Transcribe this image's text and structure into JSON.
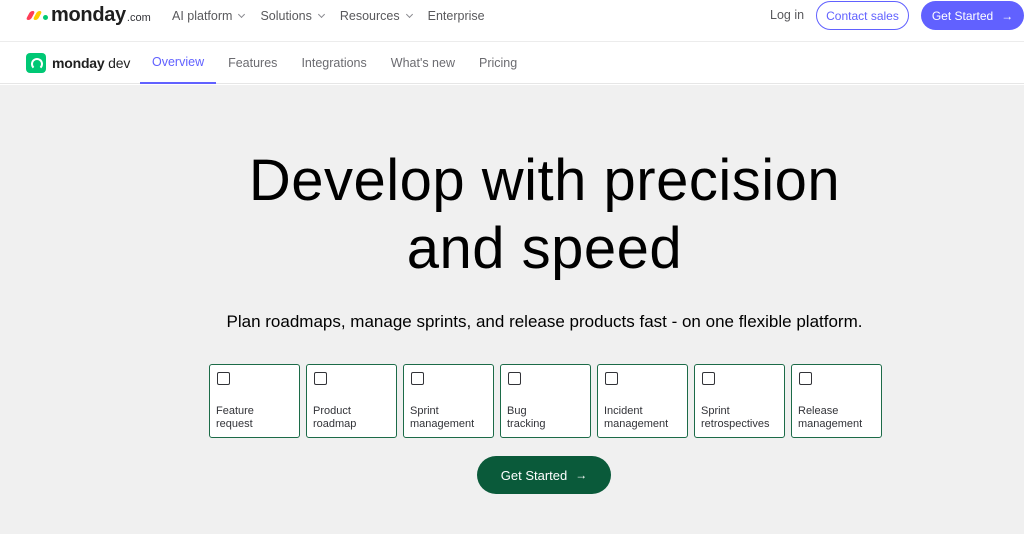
{
  "header": {
    "brand": "monday",
    "brand_tld": ".com",
    "nav": [
      {
        "label": "AI platform",
        "dropdown": true
      },
      {
        "label": "Solutions",
        "dropdown": true
      },
      {
        "label": "Resources",
        "dropdown": true
      },
      {
        "label": "Enterprise",
        "dropdown": false
      }
    ],
    "login": "Log in",
    "contact_sales": "Contact sales",
    "get_started": "Get Started",
    "accent_color": "#6161ff"
  },
  "subnav": {
    "product_bold": "monday",
    "product_light": " dev",
    "tabs": [
      {
        "label": "Overview",
        "active": true
      },
      {
        "label": "Features",
        "active": false
      },
      {
        "label": "Integrations",
        "active": false
      },
      {
        "label": "What's new",
        "active": false
      },
      {
        "label": "Pricing",
        "active": false
      }
    ]
  },
  "hero": {
    "headline_line1": "Develop with precision",
    "headline_line2": "and speed",
    "subtitle": "Plan roadmaps, manage sprints, and release products fast - on one flexible platform.",
    "options": [
      {
        "line1": "Feature",
        "line2": "request"
      },
      {
        "line1": "Product",
        "line2": "roadmap"
      },
      {
        "line1": "Sprint",
        "line2": "management"
      },
      {
        "line1": "Bug",
        "line2": "tracking"
      },
      {
        "line1": "Incident",
        "line2": "management"
      },
      {
        "line1": "Sprint",
        "line2": "retrospectives"
      },
      {
        "line1": "Release",
        "line2": "management"
      }
    ],
    "cta": "Get Started",
    "cta_color": "#0a5a3a",
    "background": "#f0f0f0"
  }
}
